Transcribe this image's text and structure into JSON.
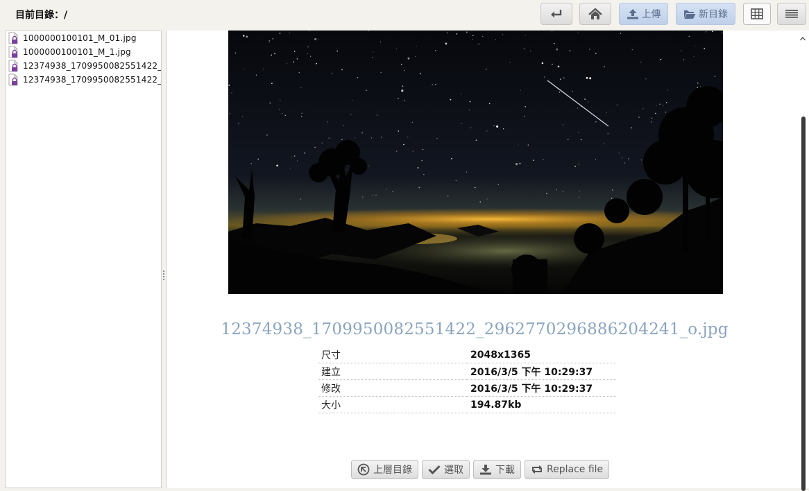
{
  "header": {
    "current_dir_label": "目前目錄：/",
    "buttons": {
      "back_icon": "return-arrow-icon",
      "home_icon": "home-icon",
      "upload_label": "上傳",
      "new_folder_label": "新目錄",
      "grid_view_icon": "grid-view-icon",
      "list_view_icon": "list-view-icon"
    }
  },
  "tree": {
    "items": [
      {
        "name": "1000000100101_M_01.jpg",
        "icon": "locked-file-icon"
      },
      {
        "name": "1000000100101_M_1.jpg",
        "icon": "locked-file-icon"
      },
      {
        "name": "12374938_1709950082551422_",
        "icon": "locked-file-icon"
      },
      {
        "name": "12374938_1709950082551422_",
        "icon": "locked-file-icon"
      }
    ]
  },
  "preview": {
    "file_name": "12374938_1709950082551422_2962770296886204241_o.jpg",
    "details": [
      {
        "key": "尺寸",
        "value": "2048x1365"
      },
      {
        "key": "建立",
        "value": "2016/3/5 下午 10:29:37"
      },
      {
        "key": "修改",
        "value": "2016/3/5 下午 10:29:37"
      },
      {
        "key": "大小",
        "value": "194.87kb"
      }
    ],
    "actions": {
      "parent_dir_label": "上層目錄",
      "select_label": "選取",
      "download_label": "下載",
      "replace_label": "Replace file"
    }
  },
  "colors": {
    "title_blue": "#8aa4bf",
    "accent_button": "#c6d5ec",
    "lock_purple": "#7b3fa0"
  }
}
